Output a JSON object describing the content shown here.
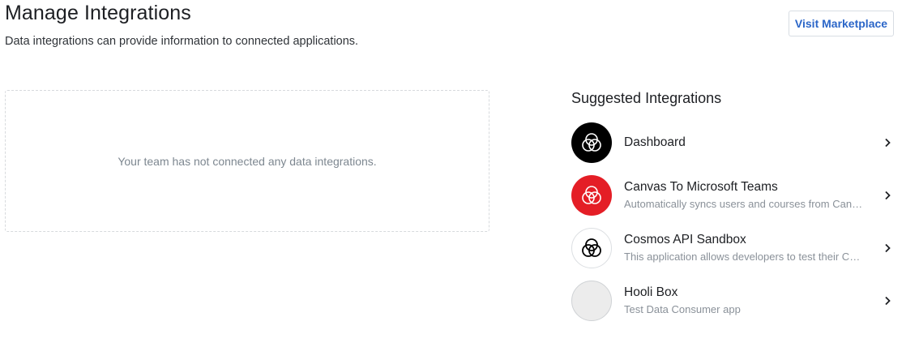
{
  "header": {
    "title": "Manage Integrations",
    "subtitle": "Data integrations can provide information to connected applications.",
    "marketplace_label": "Visit Marketplace"
  },
  "empty_state": {
    "message": "Your team has not connected any data integrations."
  },
  "suggested": {
    "title": "Suggested Integrations",
    "items": [
      {
        "name": "Dashboard",
        "description": "",
        "icon": "cosmos-logo-icon",
        "logo_bg": "#000000",
        "logo_fg": "#ffffff"
      },
      {
        "name": "Canvas To Microsoft Teams",
        "description": "Automatically syncs users and courses from Canvas to Microsoft Teams",
        "icon": "cosmos-logo-icon",
        "logo_bg": "#e41e26",
        "logo_fg": "#ffffff"
      },
      {
        "name": "Cosmos API Sandbox",
        "description": "This application allows developers to test their Cosmos API integrations",
        "icon": "cosmos-logo-icon",
        "logo_bg": "#ffffff",
        "logo_fg": "#000000"
      },
      {
        "name": "Hooli Box",
        "description": "Test Data Consumer app",
        "icon": "blank-avatar-icon",
        "logo_bg": "#ececec",
        "logo_fg": ""
      }
    ]
  }
}
